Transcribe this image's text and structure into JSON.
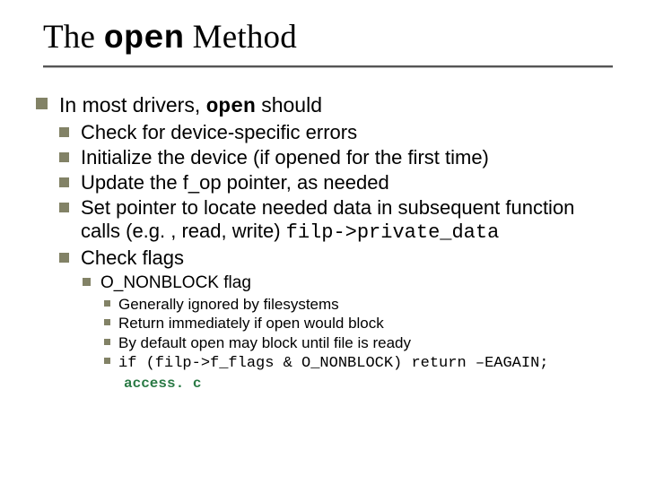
{
  "title_pre": "The ",
  "title_code": "open",
  "title_post": " Method",
  "lvl1_pre": "In most drivers, ",
  "lvl1_code": "open",
  "lvl1_post": " should",
  "sub": {
    "a": "Check for device-specific errors",
    "b": "Initialize the device (if opened for the first time)",
    "c": "Update the f_op pointer, as needed",
    "d_pre": "Set pointer to locate needed data in subsequent function calls (e.g. , read, write)     ",
    "d_code": "filp->private_data",
    "e": "Check flags"
  },
  "lvl3_a": "O_NONBLOCK flag",
  "lvl4": {
    "a": "Generally ignored by filesystems",
    "b": "Return immediately if open would block",
    "c": "By default open may block until file is ready",
    "d_code": "if (filp->f_flags & O_NONBLOCK) return –EAGAIN;",
    "d_src": "access. c"
  }
}
